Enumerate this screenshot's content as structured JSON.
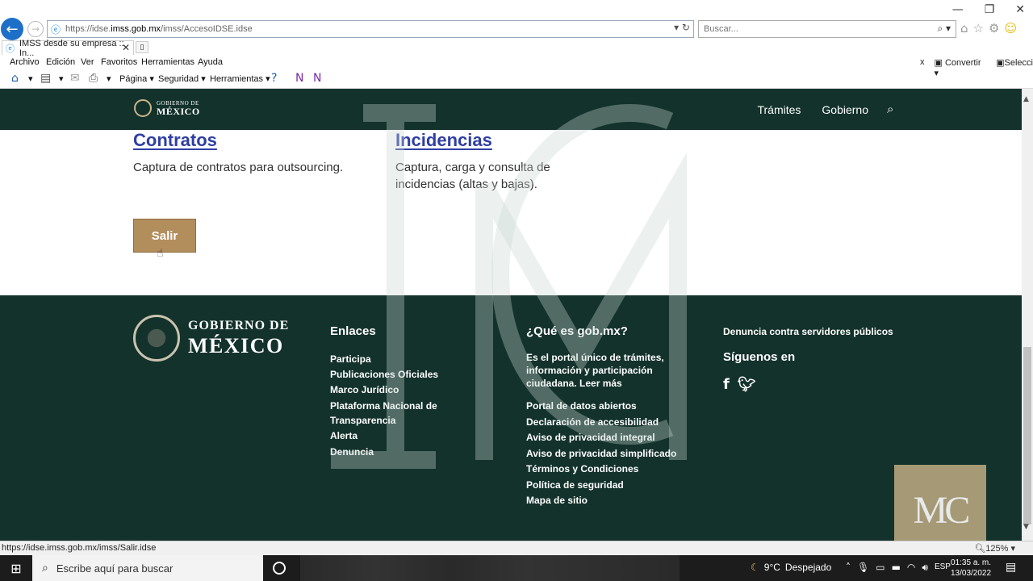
{
  "browser": {
    "url_prefix": "https://idse.",
    "url_domain": "imss.gob.mx",
    "url_path": "/imss/AccesoIDSE.idse",
    "search_placeholder": "Buscar...",
    "tab_title": "IMSS desde su empresa :: In...",
    "menu": [
      "Archivo",
      "Edición",
      "Ver",
      "Favoritos",
      "Herramientas",
      "Ayuda"
    ],
    "menu_right": {
      "close": "x",
      "convert": "Convertir",
      "select": "Selecci"
    },
    "commands": {
      "page": "Página",
      "security": "Seguridad",
      "tools": "Herramientas"
    }
  },
  "header": {
    "logo_line1": "GOBIERNO DE",
    "logo_line2": "MÉXICO",
    "nav": [
      "Trámites",
      "Gobierno"
    ]
  },
  "content": {
    "cards": [
      {
        "title": "Contratos",
        "desc": "Captura de contratos para outsourcing."
      },
      {
        "title": "Incidencias",
        "desc_line1": "Captura, carga y consulta de",
        "desc_line2": "incidencias (altas y bajas)."
      }
    ],
    "exit_label": "Salir"
  },
  "footer": {
    "logo_line1": "GOBIERNO DE",
    "logo_line2": "MÉXICO",
    "links_title": "Enlaces",
    "links": [
      "Participa",
      "Publicaciones Oficiales",
      "Marco Jurídico",
      "Plataforma Nacional de",
      "Transparencia",
      "Alerta",
      "Denuncia"
    ],
    "about_title": "¿Qué es gob.mx?",
    "about_text": "Es el portal único de trámites, información y participación ciudadana. Leer más",
    "about_links": [
      "Portal de datos abiertos",
      "Declaración de accesibilidad",
      "Aviso de privacidad integral",
      "Aviso de privacidad simplificado",
      "Términos y Condiciones",
      "Política de seguridad",
      "Mapa de sitio"
    ],
    "report": "Denuncia contra servidores públicos",
    "follow": "Síguenos en",
    "social": [
      "f"
    ]
  },
  "status": {
    "url": "https://idse.imss.gob.mx/imss/Salir.idse",
    "zoom": "125%"
  },
  "taskbar": {
    "search_placeholder": "Escribe aquí para buscar",
    "weather_temp": "9°C",
    "weather_desc": "Despejado",
    "lang": "ESP",
    "time": "01:35 a. m.",
    "date": "13/03/2022"
  }
}
